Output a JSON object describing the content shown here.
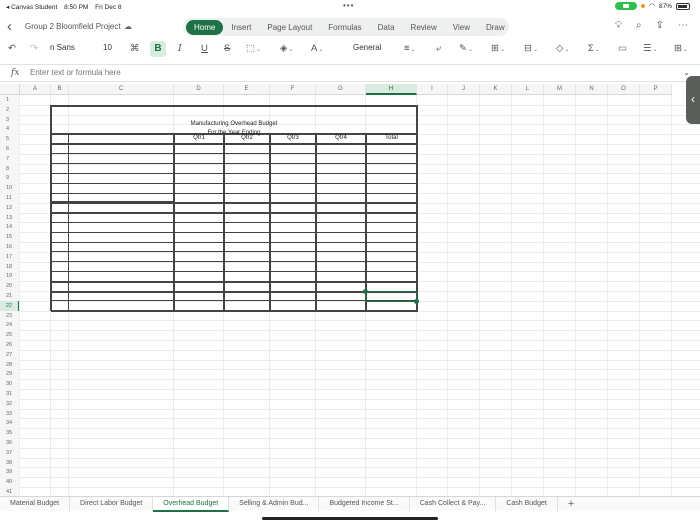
{
  "status_bar": {
    "app_back": "◂ Canvas Student",
    "time": "8:50 PM",
    "date": "Fri Dec 8",
    "battery": "87%"
  },
  "document": {
    "title": "Group 2 Bloomfield Project"
  },
  "ribbon_tabs": [
    "Home",
    "Insert",
    "Page Layout",
    "Formulas",
    "Data",
    "Review",
    "View",
    "Draw"
  ],
  "active_ribbon_tab": "Home",
  "toolbar": {
    "font_name": "n Sans",
    "font_size": "10",
    "number_format": "General"
  },
  "formula_bar": {
    "fx_label": "fx",
    "placeholder": "Enter text or formula here"
  },
  "columns": [
    "A",
    "B",
    "C",
    "D",
    "E",
    "F",
    "G",
    "H",
    "I",
    "J",
    "K",
    "L",
    "M",
    "N",
    "O",
    "P"
  ],
  "selected_column": "H",
  "rows": [
    "1",
    "2",
    "3",
    "4",
    "5",
    "6",
    "7",
    "8",
    "9",
    "10",
    "11",
    "12",
    "13",
    "14",
    "15",
    "16",
    "17",
    "18",
    "19",
    "20",
    "21",
    "22",
    "23",
    "24",
    "25",
    "26",
    "27",
    "28",
    "29",
    "30",
    "31",
    "32",
    "33",
    "34",
    "35",
    "36",
    "37",
    "38",
    "39",
    "40",
    "41"
  ],
  "selected_row": "22",
  "sheet": {
    "title": "Manufacturing Overhead Budget",
    "subtitle": "For the Year Ending",
    "headers": [
      "Qtr1",
      "Qtr2",
      "Qtr3",
      "Qtr4",
      "Total"
    ]
  },
  "sheet_tabs": [
    "Material Budget",
    "Direct Labor Budget",
    "Overhead Budget",
    "Selling & Admin Bud...",
    "Budgeted Income St...",
    "Cash Collect & Pay...",
    "Cash Budget"
  ],
  "active_sheet_tab": "Overhead Budget",
  "colors": {
    "accent": "#1e7145",
    "selection_bg": "#d9ebe0"
  }
}
